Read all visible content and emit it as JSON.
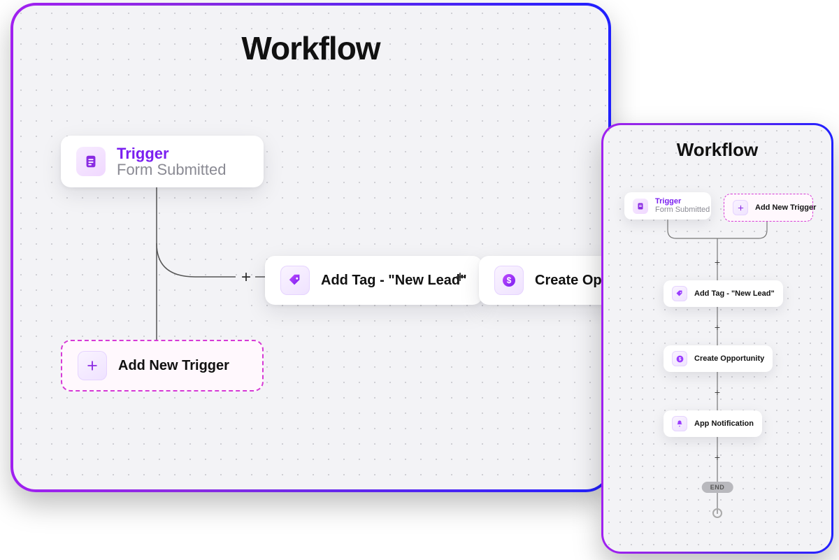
{
  "desktop": {
    "title": "Workflow",
    "trigger": {
      "title": "Trigger",
      "subtitle": "Form Submitted"
    },
    "addTrigger": {
      "label": "Add New Trigger"
    },
    "step1": {
      "label": "Add Tag - \"New Lead\""
    },
    "step2": {
      "label": "Create Oppo"
    }
  },
  "mobile": {
    "title": "Workflow",
    "trigger": {
      "title": "Trigger",
      "subtitle": "Form Submitted"
    },
    "addTrigger": {
      "label": "Add New Trigger"
    },
    "step1": {
      "label": "Add Tag - \"New Lead\""
    },
    "step2": {
      "label": "Create Opportunity"
    },
    "step3": {
      "label": "App Notification"
    },
    "end": "END"
  }
}
